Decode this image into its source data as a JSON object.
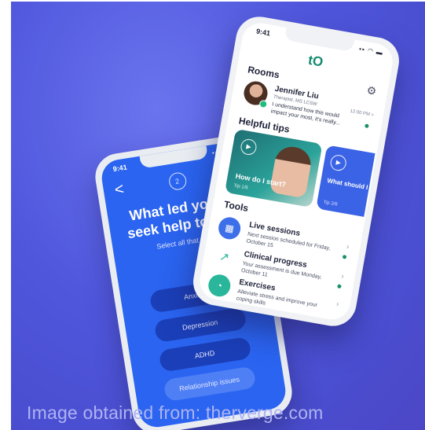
{
  "caption": "Image obtained from: therverge.com",
  "left_phone": {
    "time": "9:41",
    "status_icons": "▪▪ ◠ ▬",
    "back_icon": "<",
    "close_icon": "✕",
    "step_badge": "2",
    "question": "What led you to seek help today?",
    "subtitle": "Select all that apply",
    "options": [
      "Anxiety",
      "Depression",
      "ADHD",
      "Relationship issues"
    ],
    "colors": {
      "screen": "#2a64f0",
      "option": "#1b3fb8"
    }
  },
  "right_phone": {
    "time": "9:41",
    "status_icons": "▪▪ ◠ ▬",
    "logo": "tO",
    "rooms_heading": "Rooms",
    "room": {
      "name": "Jennifer Liu",
      "credentials": "Therapist, MS LCSW",
      "message": "I understand how this would impact your most, it's really...",
      "time": "12:00 PM >"
    },
    "tips_heading": "Helpful tips",
    "tips": [
      {
        "title": "How do I start?",
        "label": "Tip 1/6"
      },
      {
        "title": "What should I expect from my therapist?",
        "label": "Tip 2/6"
      }
    ],
    "tools_heading": "Tools",
    "tools": [
      {
        "title": "Live sessions",
        "desc": "Next session scheduled for Friday, October 15",
        "icon": "calendar-icon"
      },
      {
        "title": "Clinical progress",
        "desc": "Your assessment is due Monday, October 11",
        "icon": "trend-icon"
      },
      {
        "title": "Exercises",
        "desc": "Alleviate stress and improve your coping skills",
        "icon": "exercises-icon"
      }
    ],
    "colors": {
      "brand": "#138a6e",
      "tool_blue": "#3d6fe8",
      "tool_teal": "#29b69a"
    }
  }
}
